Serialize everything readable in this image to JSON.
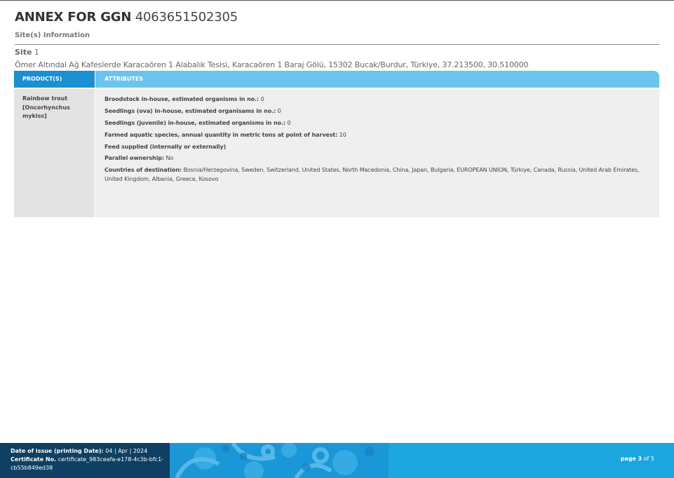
{
  "header": {
    "title_prefix": "ANNEX FOR GGN",
    "title_number": "4063651502305",
    "section_title": "Site(s) Information"
  },
  "site": {
    "label": "Site",
    "number": "1",
    "address": "Ömer Altındal Ağ Kafeslerde Karacaören 1 Alabalık Tesisi, Karacaören 1 Baraj Gölü, 15302 Bucak/Burdur, Türkiye, 37.213500, 30.510000"
  },
  "table": {
    "col_product": "PRODUCT(S)",
    "col_attributes": "ATTRIBUTES",
    "product_name": "Rainbow trout [Oncorhynchus mykiss]",
    "attributes": [
      {
        "label": "Broodstock in-house, estimated organisms in no.:",
        "value": "0"
      },
      {
        "label": "Seedlings (ova) in-house, estimated organisams in no.:",
        "value": "0"
      },
      {
        "label": "Seedlings (juvenile) in-house, estimated organisms in no.:",
        "value": "0"
      },
      {
        "label": "Farmed aquatic species, annual quantity in metric tons at point of harvest:",
        "value": "10"
      },
      {
        "label": "Feed supplied (internally or externally)",
        "value": ""
      },
      {
        "label": "Parallel ownership:",
        "value": "No"
      },
      {
        "label": "Countries of destination:",
        "value": "Bosnia/Herzegovina, Sweden, Switzerland, United States, North Macedonia, China, Japan, Bulgaria, EUROPEAN UNION, Türkiye, Canada, Russia, United Arab Emirates, United Kingdom, Albania, Greece, Kosovo"
      }
    ]
  },
  "footer": {
    "issue_label": "Date of issue (printing Date):",
    "issue_date": "04 | Apr | 2024",
    "cert_label": "Certificate No.",
    "cert_number": "certificate_983ceafa-e178-4c3b-bfc1-cb55b849ed38",
    "page_label": "page",
    "page_current": "3",
    "page_of": "of",
    "page_total": "5"
  },
  "colors": {
    "header_dark_blue": "#1a8fd1",
    "header_light_blue": "#6ac4ee",
    "footer_navy": "#0f3f62",
    "footer_blue": "#1a9fd8"
  }
}
